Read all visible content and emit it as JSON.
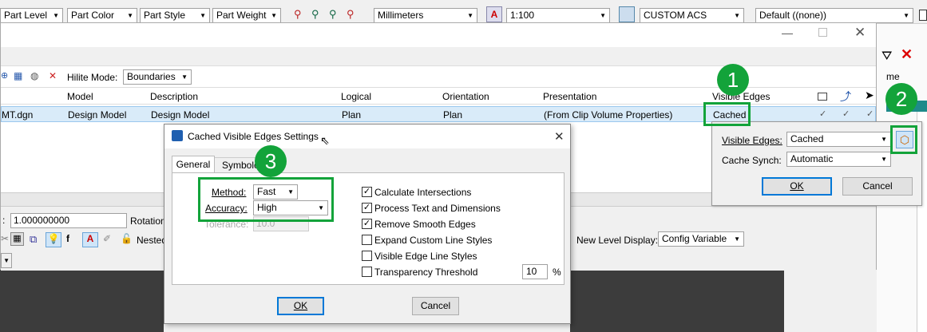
{
  "top_toolbar": {
    "part_level": "Part Level",
    "part_color": "Part Color",
    "part_style": "Part Style",
    "part_weight": "Part Weight",
    "units": "Millimeters",
    "scale": "1:100",
    "acs": "CUSTOM ACS",
    "default_display": "Default ((none))"
  },
  "main_window": {
    "hilite_mode_label": "Hilite Mode:",
    "hilite_mode_value": "Boundaries",
    "columns": [
      "Model",
      "Description",
      "Logical",
      "Orientation",
      "Presentation",
      "Visible Edges"
    ],
    "row": {
      "file": "MT.dgn",
      "model": "Design Model",
      "description": "Design Model",
      "logical": "Plan",
      "orientation": "Plan",
      "presentation": "(From Clip Volume Properties)",
      "visible_edges": "Cached"
    },
    "scale_value": "1.000000000",
    "rotation_label": "Rotation",
    "nested_label": "Nested",
    "new_level_display_label": "New Level Display:",
    "new_level_display_value": "Config Variable"
  },
  "right_panel": {
    "partial_text_me": "me",
    "visible_edges_label": "Visible Edges:",
    "visible_edges_value": "Cached",
    "cache_synch_label": "Cache Synch:",
    "cache_synch_value": "Automatic",
    "ok": "OK",
    "cancel": "Cancel"
  },
  "dialog": {
    "title": "Cached Visible Edges Settings",
    "tabs": [
      "General",
      "Symbology"
    ],
    "method_label": "Method:",
    "method_value": "Fast",
    "accuracy_label": "Accuracy:",
    "accuracy_value": "High",
    "tolerance_label": "Tolerance:",
    "tolerance_value": "10.0",
    "options": [
      {
        "label": "Calculate Intersections",
        "checked": true
      },
      {
        "label": "Process Text and Dimensions",
        "checked": true
      },
      {
        "label": "Remove Smooth Edges",
        "checked": true
      },
      {
        "label": "Expand Custom Line Styles",
        "checked": false
      },
      {
        "label": "Visible Edge Line Styles",
        "checked": false
      },
      {
        "label": "Transparency Threshold",
        "checked": false
      }
    ],
    "threshold_value": "10",
    "percent": "%",
    "ok": "OK",
    "cancel": "Cancel"
  },
  "callouts": [
    "1",
    "2",
    "3"
  ],
  "colors": {
    "callout_green": "#13a33a",
    "selection_blue": "#0078d7",
    "dark_bg": "#3c3c3c"
  }
}
